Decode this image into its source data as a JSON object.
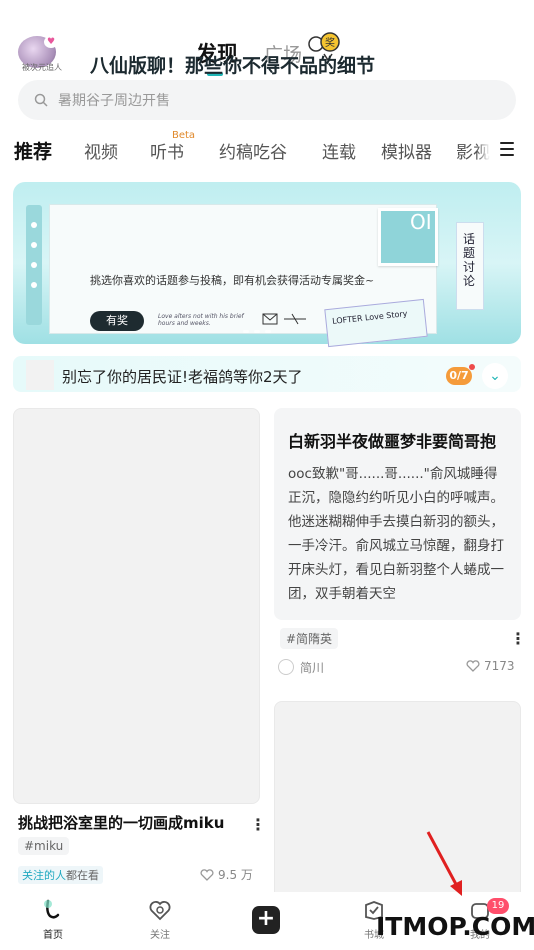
{
  "header": {
    "avatar_caption": "被次元追人",
    "tabs": [
      {
        "label": "发现",
        "active": true
      },
      {
        "label": "广场",
        "active": false
      }
    ],
    "sticker_text": "奖"
  },
  "search": {
    "placeholder": "暑期谷子周边开售"
  },
  "categories": [
    {
      "label": "推荐",
      "active": true
    },
    {
      "label": "视频"
    },
    {
      "label": "听书",
      "badge": "Beta"
    },
    {
      "label": "约稿吃谷"
    },
    {
      "label": "连载"
    },
    {
      "label": "模拟器"
    },
    {
      "label": "影视"
    }
  ],
  "banner": {
    "title": "八仙版聊！那些你不得不品的细节",
    "subtitle": "挑选你喜欢的话题参与投稿，即有机会获得活动专属奖金~",
    "tag": "有奖",
    "side_text": "话题讨论",
    "stamp_text": "OI",
    "small_text": "Love alters not with his brief hours and weeks.",
    "card_text": "LOFTER Love Story"
  },
  "notice": {
    "text": "别忘了你的居民证!老福鸽等你2天了",
    "count": "0/7"
  },
  "feed": {
    "left": {
      "title": "挑战把浴室里的一切画成miku",
      "tag": "#miku",
      "follow_highlight": "关注的人",
      "follow_rest": "都在看",
      "likes": "9.5 万"
    },
    "right": {
      "title": "白新羽半夜做噩梦非要简哥抱",
      "body": "ooc致歉\"哥......哥......\"俞风城睡得正沉，隐隐约约听见小白的呼喊声。他迷迷糊糊伸手去摸白新羽的额头，一手冷汗。俞风城立马惊醒，翻身打开床头灯，看见白新羽整个人蜷成一团，双手朝着天空",
      "tag": "#简隋英",
      "author": "简川",
      "likes": "7173"
    }
  },
  "bottom_nav": {
    "items": [
      {
        "label": "首页"
      },
      {
        "label": "关注"
      },
      {
        "label": "书城"
      },
      {
        "label": "我的"
      }
    ],
    "badge": "19"
  },
  "watermark": "ITMOP.COM",
  "colors": {
    "accent": "#21b6b6",
    "badge_orange": "#f59b3a",
    "badge_red": "#ff4e6b"
  }
}
